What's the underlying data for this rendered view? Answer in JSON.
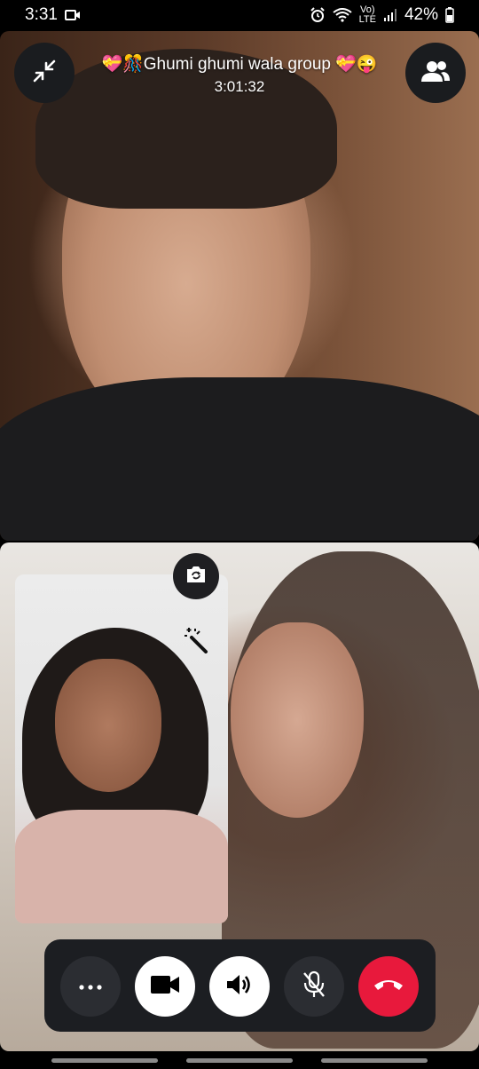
{
  "status_bar": {
    "time": "3:31",
    "network_label_top": "Vo)",
    "network_label_bottom": "LTE",
    "battery": "42%"
  },
  "call": {
    "title": "💝🎊Ghumi ghumi wala group 💝😜",
    "timer": "3:01:32"
  },
  "icons": {
    "minimize": "minimize-icon",
    "participants": "participants-icon",
    "camera_flip": "camera-flip-icon",
    "effects": "magic-wand-icon"
  },
  "controls": [
    {
      "name": "more-options-button",
      "icon": "more-icon"
    },
    {
      "name": "video-button",
      "icon": "video-camera-icon"
    },
    {
      "name": "speaker-button",
      "icon": "speaker-icon"
    },
    {
      "name": "mute-button",
      "icon": "mic-off-icon"
    },
    {
      "name": "end-call-button",
      "icon": "end-call-icon"
    }
  ],
  "colors": {
    "end_call": "#e8193c",
    "control_bar": "#1c1e22"
  }
}
